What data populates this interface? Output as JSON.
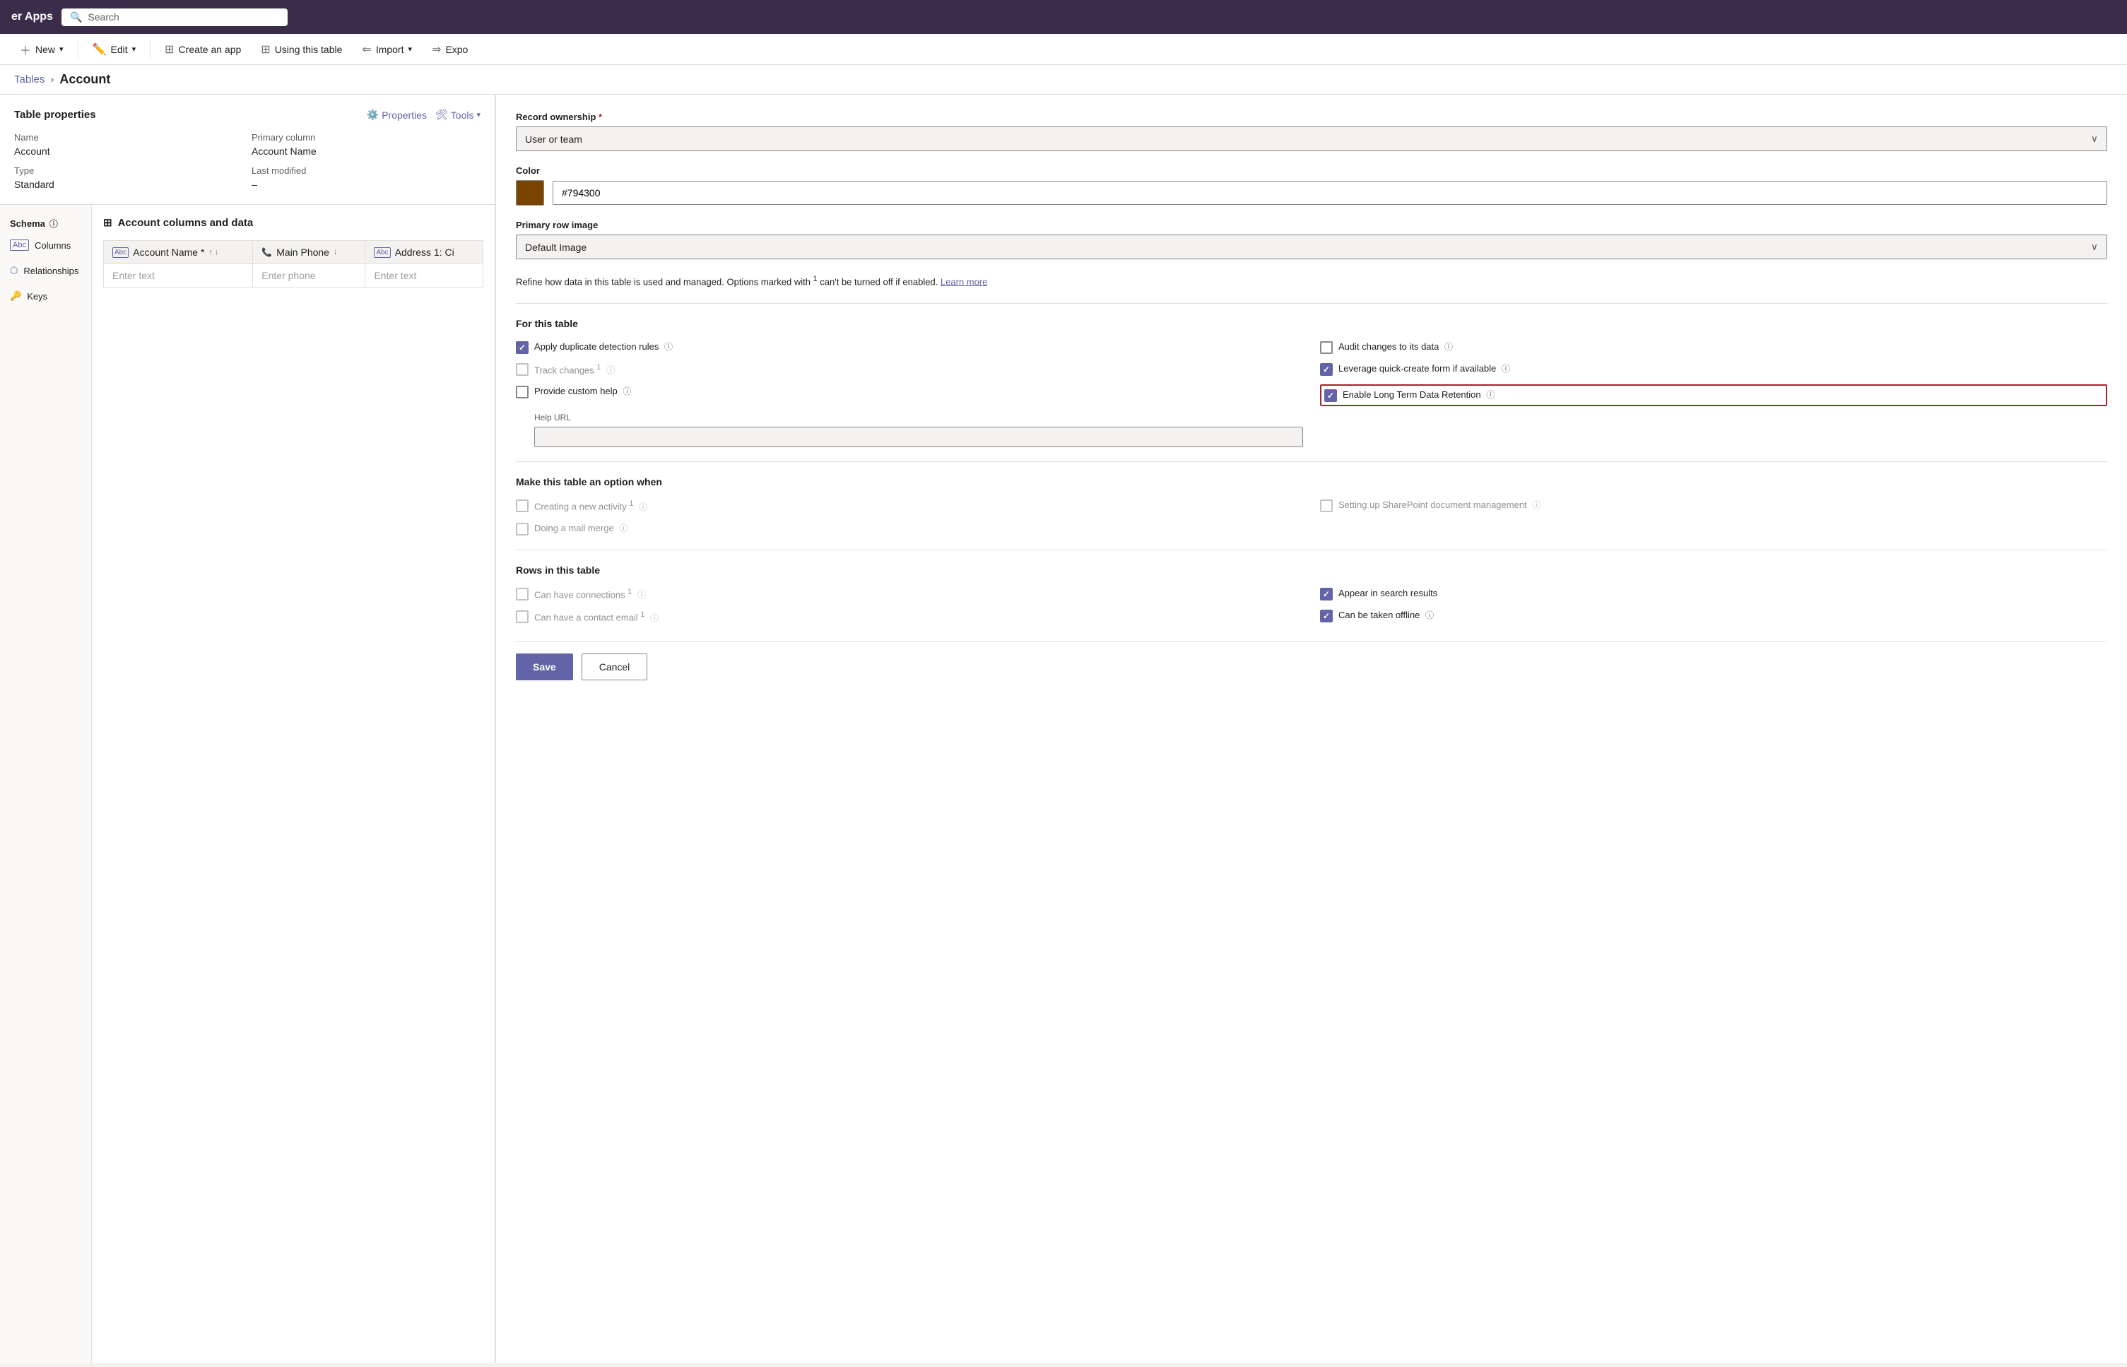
{
  "app": {
    "title": "er Apps",
    "search_placeholder": "Search"
  },
  "toolbar": {
    "new_label": "New",
    "edit_label": "Edit",
    "create_app_label": "Create an app",
    "using_table_label": "Using this table",
    "import_label": "Import",
    "export_label": "Expo"
  },
  "breadcrumb": {
    "parent": "Tables",
    "separator": "›",
    "current": "Account"
  },
  "table_properties": {
    "title": "Table properties",
    "properties_link": "Properties",
    "tools_link": "Tools",
    "name_label": "Name",
    "name_value": "Account",
    "primary_column_label": "Primary column",
    "primary_column_value": "Account Name",
    "type_label": "Type",
    "type_value": "Standard",
    "last_modified_label": "Last modified",
    "last_modified_value": "–"
  },
  "schema": {
    "title": "Schema",
    "items": [
      {
        "label": "Columns",
        "icon": "abc"
      },
      {
        "label": "Relationships",
        "icon": "rel"
      },
      {
        "label": "Keys",
        "icon": "key"
      }
    ]
  },
  "data_section": {
    "title": "Account columns and data",
    "columns": [
      {
        "icon": "abc",
        "label": "Account Name",
        "required": true,
        "sort": true
      },
      {
        "icon": "phone",
        "label": "Main Phone",
        "required": false,
        "sort": false
      },
      {
        "icon": "abc",
        "label": "Address 1: Ci",
        "required": false,
        "sort": false
      }
    ],
    "placeholder_row": {
      "col1": "Enter text",
      "col2": "Enter phone",
      "col3": "Enter text"
    }
  },
  "right_panel": {
    "record_ownership_label": "Record ownership",
    "record_ownership_required": true,
    "record_ownership_value": "User or team",
    "color_label": "Color",
    "color_hex": "#794300",
    "color_swatch": "#794300",
    "primary_row_image_label": "Primary row image",
    "primary_row_image_value": "Default Image",
    "refine_text": "Refine how data in this table is used and managed. Options marked with",
    "refine_superscript": "1",
    "refine_text2": "can't be turned off if enabled.",
    "learn_more": "Learn more",
    "for_this_table_title": "For this table",
    "options": [
      {
        "id": "apply_dup",
        "label": "Apply duplicate detection rules",
        "checked": true,
        "disabled": false,
        "info": true,
        "col": 1
      },
      {
        "id": "audit_changes",
        "label": "Audit changes to its data",
        "checked": false,
        "disabled": false,
        "info": true,
        "col": 2
      },
      {
        "id": "track_changes",
        "label": "Track changes",
        "checked": false,
        "disabled": true,
        "info": true,
        "superscript": "1",
        "col": 1
      },
      {
        "id": "leverage_quick",
        "label": "Leverage quick-create form if available",
        "checked": true,
        "disabled": false,
        "info": true,
        "col": 2
      },
      {
        "id": "provide_custom_help",
        "label": "Provide custom help",
        "checked": false,
        "disabled": false,
        "info": true,
        "col": 1
      },
      {
        "id": "enable_ltdr",
        "label": "Enable Long Term Data Retention",
        "checked": true,
        "disabled": false,
        "info": true,
        "col": 2,
        "highlighted": true
      }
    ],
    "help_url_label": "Help URL",
    "make_option_title": "Make this table an option when",
    "make_options": [
      {
        "id": "creating_activity",
        "label": "Creating a new activity",
        "checked": false,
        "disabled": true,
        "info": true,
        "superscript": "1",
        "col": 1
      },
      {
        "id": "sharepoint",
        "label": "Setting up SharePoint document management",
        "checked": false,
        "disabled": true,
        "info": true,
        "col": 2
      },
      {
        "id": "mail_merge",
        "label": "Doing a mail merge",
        "checked": false,
        "disabled": true,
        "info": true,
        "col": 1
      }
    ],
    "rows_title": "Rows in this table",
    "row_options": [
      {
        "id": "connections",
        "label": "Can have connections",
        "checked": false,
        "disabled": true,
        "info": true,
        "superscript": "1",
        "col": 1
      },
      {
        "id": "appear_search",
        "label": "Appear in search results",
        "checked": true,
        "disabled": false,
        "info": false,
        "col": 2
      },
      {
        "id": "contact_email",
        "label": "Can have a contact email",
        "checked": false,
        "disabled": true,
        "info": true,
        "superscript": "1",
        "col": 1
      },
      {
        "id": "taken_offline",
        "label": "Can be taken offline",
        "checked": true,
        "disabled": false,
        "info": true,
        "col": 2
      }
    ],
    "save_label": "Save",
    "cancel_label": "Cancel"
  }
}
